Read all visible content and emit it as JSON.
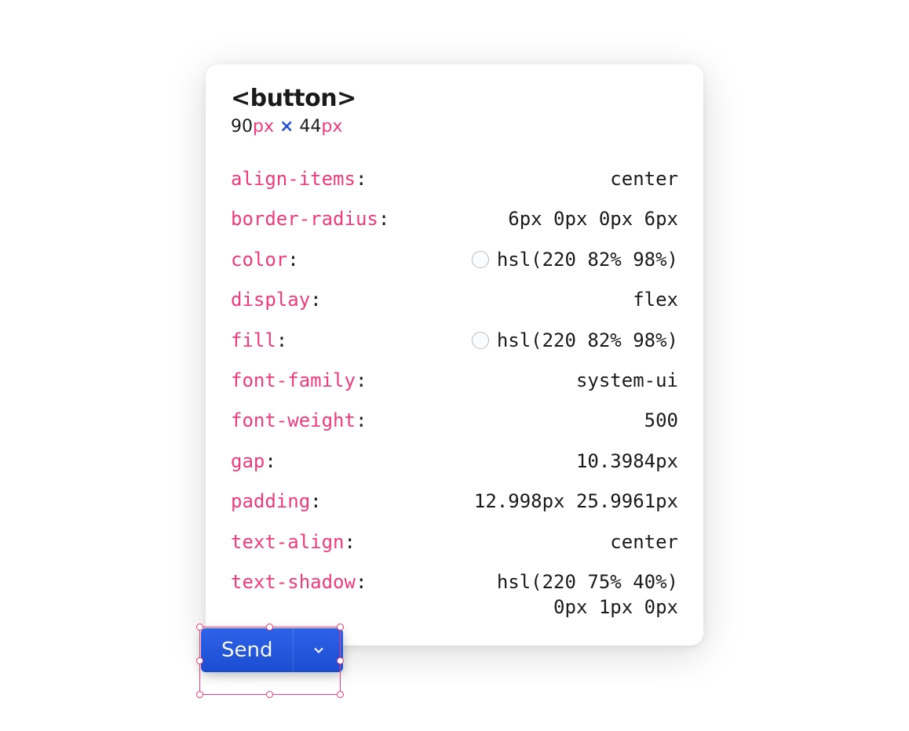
{
  "tooltip": {
    "tag": "<button>",
    "width": "90",
    "height": "44",
    "unit": "px",
    "separator": "×",
    "properties": [
      {
        "name": "align-items",
        "value": "center",
        "swatch": false
      },
      {
        "name": "border-radius",
        "value": "6px 0px 0px 6px",
        "swatch": false
      },
      {
        "name": "color",
        "value": "hsl(220 82% 98%)",
        "swatch": true
      },
      {
        "name": "display",
        "value": "flex",
        "swatch": false
      },
      {
        "name": "fill",
        "value": "hsl(220 82% 98%)",
        "swatch": true
      },
      {
        "name": "font-family",
        "value": "system-ui",
        "swatch": false
      },
      {
        "name": "font-weight",
        "value": "500",
        "swatch": false
      },
      {
        "name": "gap",
        "value": "10.3984px",
        "swatch": false
      },
      {
        "name": "padding",
        "value": "12.998px 25.9961px",
        "swatch": false
      },
      {
        "name": "text-align",
        "value": "center",
        "swatch": false
      },
      {
        "name": "text-shadow",
        "value": "hsl(220 75% 40%)\n0px 1px 0px",
        "swatch": false
      }
    ]
  },
  "buttons": {
    "send_label": "Send"
  }
}
